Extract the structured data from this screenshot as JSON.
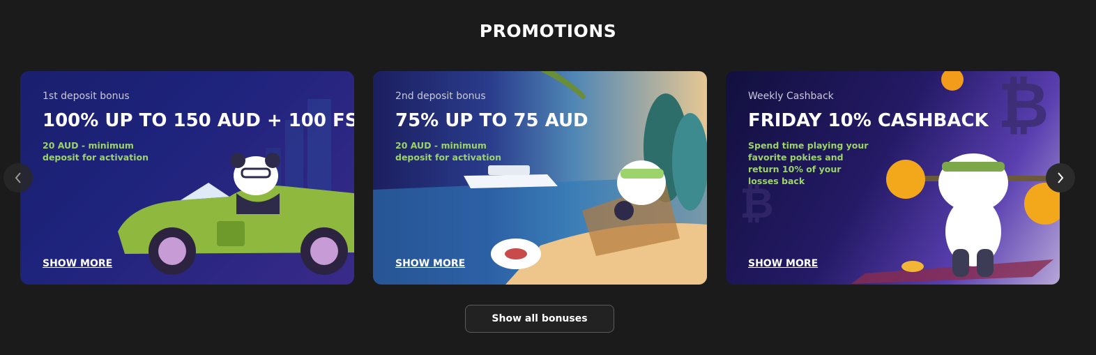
{
  "page": {
    "title": "PROMOTIONS"
  },
  "promotions": [
    {
      "eyebrow": "1st deposit bonus",
      "headline": "100% UP TO 150 AUD + 100 FS",
      "description": "20 AUD - minimum deposit for activation",
      "cta": "SHOW MORE",
      "art": "panda-in-green-convertible"
    },
    {
      "eyebrow": "2nd deposit bonus",
      "headline": "75% UP TO 75 AUD",
      "description": "20 AUD - minimum deposit for activation",
      "cta": "SHOW MORE",
      "art": "panda-on-beach-chair"
    },
    {
      "eyebrow": "Weekly Cashback",
      "headline": "FRIDAY 10% CASHBACK",
      "description": "Spend time playing your favorite pokies and return 10% of your losses back",
      "cta": "SHOW MORE",
      "art": "panda-lifting-coin-barbell"
    }
  ],
  "carousel": {
    "prev_icon": "chevron-left-icon",
    "next_icon": "chevron-right-icon"
  },
  "footer": {
    "show_all_label": "Show all bonuses"
  },
  "colors": {
    "background": "#1b1b1b",
    "accent_green": "#9cd36a"
  }
}
